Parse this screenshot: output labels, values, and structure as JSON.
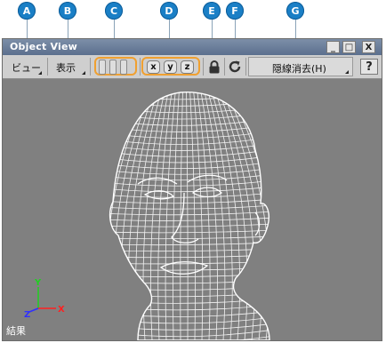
{
  "callouts": [
    "A",
    "B",
    "C",
    "D",
    "E",
    "F",
    "G"
  ],
  "window": {
    "title": "Object View",
    "controls": {
      "minimize": "_",
      "maximize": "□",
      "close": "X"
    }
  },
  "toolbar": {
    "view_menu": "ビュー",
    "display_menu": "表示",
    "axis_buttons": [
      "x",
      "y",
      "z"
    ],
    "hidden_line_menu": "隠線消去(H)",
    "help_label": "?"
  },
  "viewport": {
    "status_label": "結果",
    "axes": {
      "y": "Y",
      "x": "X",
      "z": "Z"
    },
    "colors": {
      "background": "#808080",
      "mesh": "#ffffff",
      "x": "#ff2020",
      "y": "#20d020",
      "z": "#3030ff"
    },
    "model_icon": "wireframe-head"
  }
}
